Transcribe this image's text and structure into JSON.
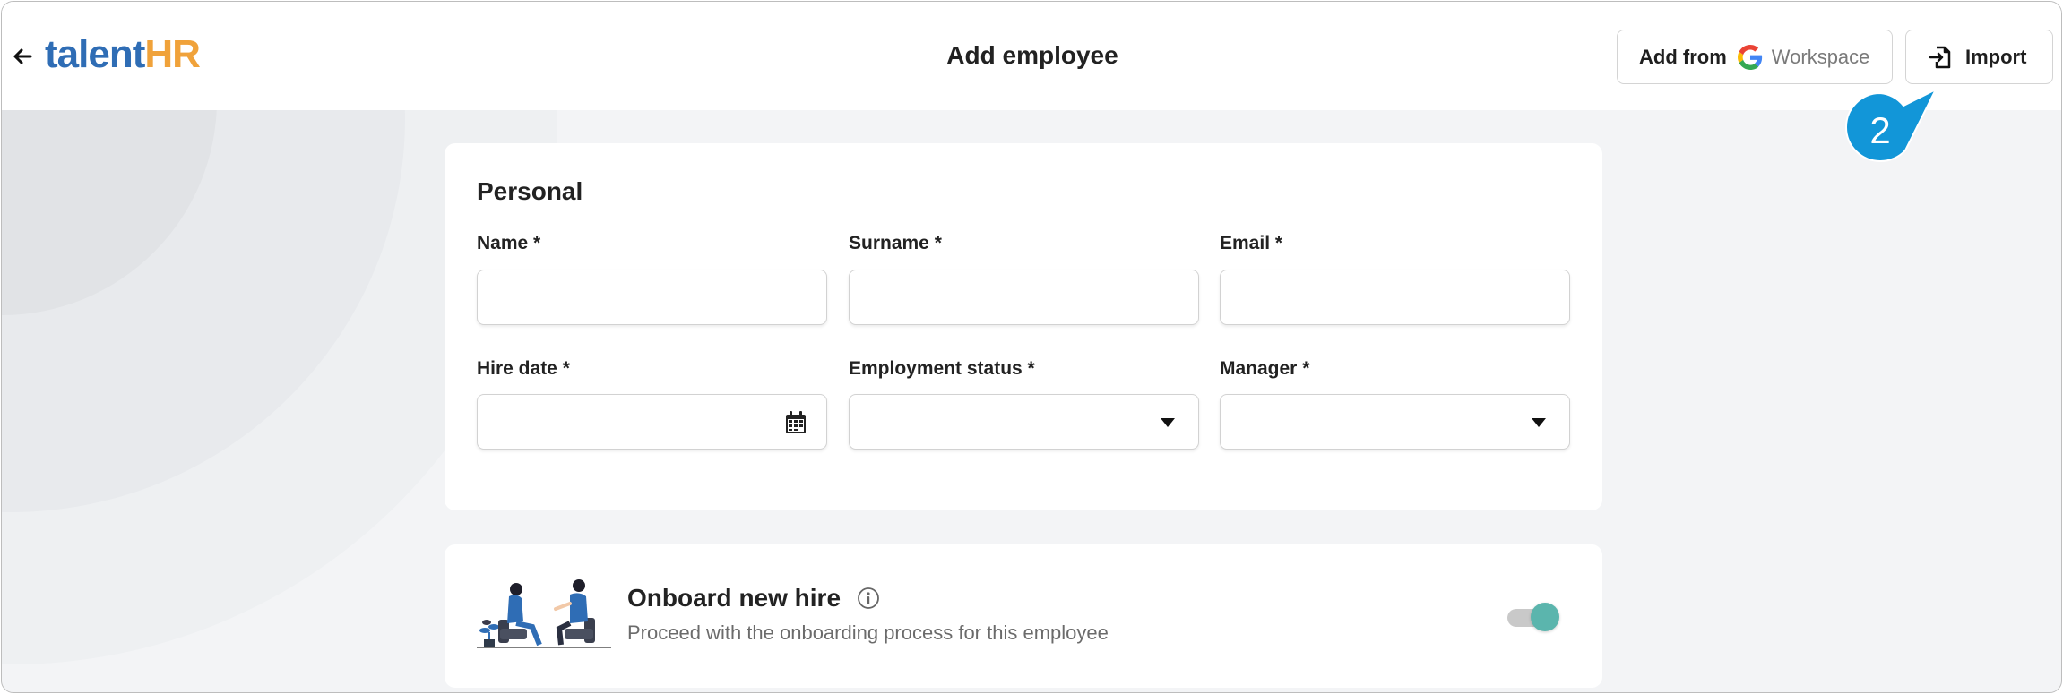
{
  "header": {
    "logo_part1": "talent",
    "logo_part2": "HR",
    "title": "Add employee",
    "add_from_label": "Add from",
    "workspace_label": "Workspace",
    "import_label": "Import"
  },
  "step_marker": "2",
  "personal": {
    "title": "Personal",
    "fields": [
      {
        "label": "Name *",
        "value": ""
      },
      {
        "label": "Surname *",
        "value": ""
      },
      {
        "label": "Email *",
        "value": ""
      },
      {
        "label": "Hire date *",
        "value": ""
      },
      {
        "label": "Employment status *",
        "value": ""
      },
      {
        "label": "Manager *",
        "value": ""
      }
    ]
  },
  "onboard": {
    "title": "Onboard new hire",
    "description": "Proceed with the onboarding process for this employee",
    "toggle_on": true
  },
  "colors": {
    "brand_blue": "#2f6db5",
    "brand_orange": "#f0a23a",
    "step_marker": "#1296d8",
    "toggle_accent": "#5bb5ad"
  },
  "icons": [
    "back-arrow-icon",
    "google-icon",
    "import-icon",
    "calendar-icon",
    "chevron-down-icon",
    "info-icon"
  ]
}
